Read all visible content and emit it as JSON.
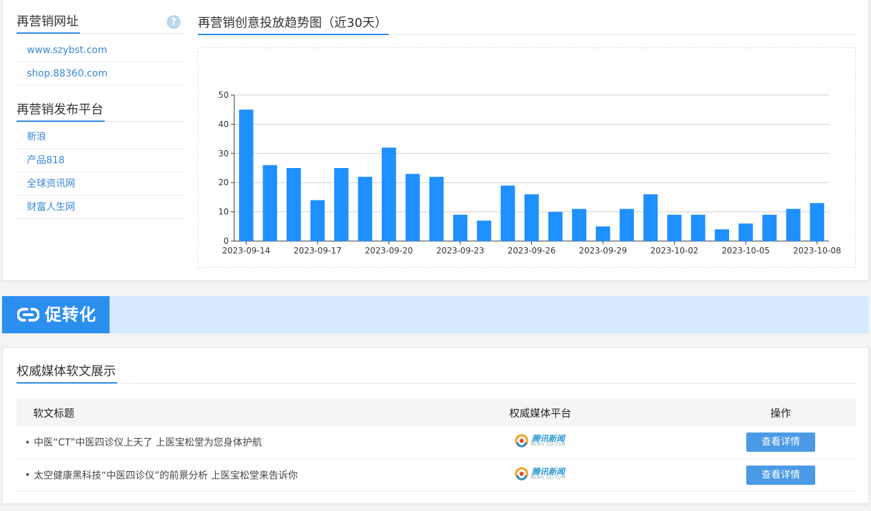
{
  "sidebar": {
    "url_section_title": "再营销网址",
    "help_glyph": "?",
    "urls": [
      "www.szybst.com",
      "shop.88360.com"
    ],
    "platform_section_title": "再营销发布平台",
    "platforms": [
      "新浪",
      "产品818",
      "全球资讯网",
      "财富人生网"
    ]
  },
  "chart_section_title": "再营销创意投放趋势图（近30天）",
  "chart_data": {
    "type": "bar",
    "categories": [
      "2023-09-14",
      "2023-09-15",
      "2023-09-16",
      "2023-09-17",
      "2023-09-18",
      "2023-09-19",
      "2023-09-20",
      "2023-09-21",
      "2023-09-22",
      "2023-09-23",
      "2023-09-24",
      "2023-09-25",
      "2023-09-26",
      "2023-09-27",
      "2023-09-28",
      "2023-09-29",
      "2023-09-30",
      "2023-10-01",
      "2023-10-02",
      "2023-10-03",
      "2023-10-04",
      "2023-10-05",
      "2023-10-06",
      "2023-10-07",
      "2023-10-08"
    ],
    "values": [
      45,
      26,
      25,
      14,
      25,
      22,
      32,
      23,
      22,
      9,
      7,
      19,
      16,
      10,
      11,
      5,
      11,
      16,
      9,
      9,
      4,
      6,
      9,
      11,
      13
    ],
    "x_tick_labels": [
      "2023-09-14",
      "2023-09-17",
      "2023-09-20",
      "2023-09-23",
      "2023-09-26",
      "2023-09-29",
      "2023-10-02",
      "2023-10-05",
      "2023-10-08"
    ],
    "y_ticks": [
      0,
      10,
      20,
      30,
      40,
      50
    ],
    "ylim": [
      0,
      50
    ],
    "grid": true,
    "bar_color": "#1e90ff"
  },
  "promo": {
    "label": "促转化",
    "icon": "link-icon",
    "accent_color": "#2b8ff0"
  },
  "media": {
    "section_title": "权威媒体软文展示",
    "columns": [
      "软文标题",
      "权威媒体平台",
      "操作"
    ],
    "rows": [
      {
        "title": "中医“CT”中医四诊仪上天了 上医宝松堂为您身体护航",
        "platform_name": "腾讯新闻",
        "platform_domain": "NEWS.QQ.COM",
        "action": "查看详情"
      },
      {
        "title": "太空健康黑科技“中医四诊仪”的前景分析 上医宝松堂来告诉你",
        "platform_name": "腾讯新闻",
        "platform_domain": "NEWS.QQ.COM",
        "action": "查看详情"
      }
    ]
  }
}
